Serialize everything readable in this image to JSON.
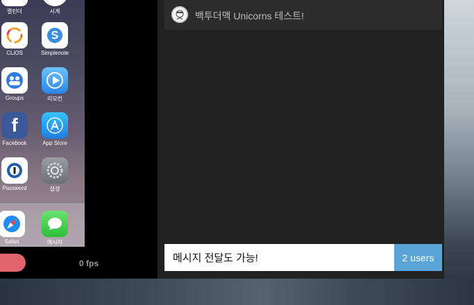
{
  "phone": {
    "apps": [
      {
        "label": "캘린더",
        "icon": "calendar-icon"
      },
      {
        "label": "시계",
        "icon": "clock-icon"
      },
      {
        "label": "CLiOS",
        "icon": "clios-icon"
      },
      {
        "label": "Simplenote",
        "icon": "simplenote-icon"
      },
      {
        "label": "Groups",
        "icon": "groups-icon"
      },
      {
        "label": "리모컨",
        "icon": "remote-icon"
      },
      {
        "label": "Facebook",
        "icon": "facebook-icon"
      },
      {
        "label": "App Store",
        "icon": "app-store-icon"
      },
      {
        "label": "Password",
        "icon": "password-icon"
      },
      {
        "label": "설정",
        "icon": "settings-icon"
      }
    ],
    "dock": [
      {
        "label": "Safari",
        "icon": "safari-icon"
      },
      {
        "label": "메시지",
        "icon": "messages-icon"
      }
    ]
  },
  "simulator": {
    "fps": "0 fps"
  },
  "chat": {
    "message_text": "백투더맥 Unicorns 테스트!",
    "input_value": "메시지 전달도 가능!",
    "users_label": "2 users"
  },
  "colors": {
    "accent": "#5aa4d8",
    "record": "#e0646e"
  }
}
